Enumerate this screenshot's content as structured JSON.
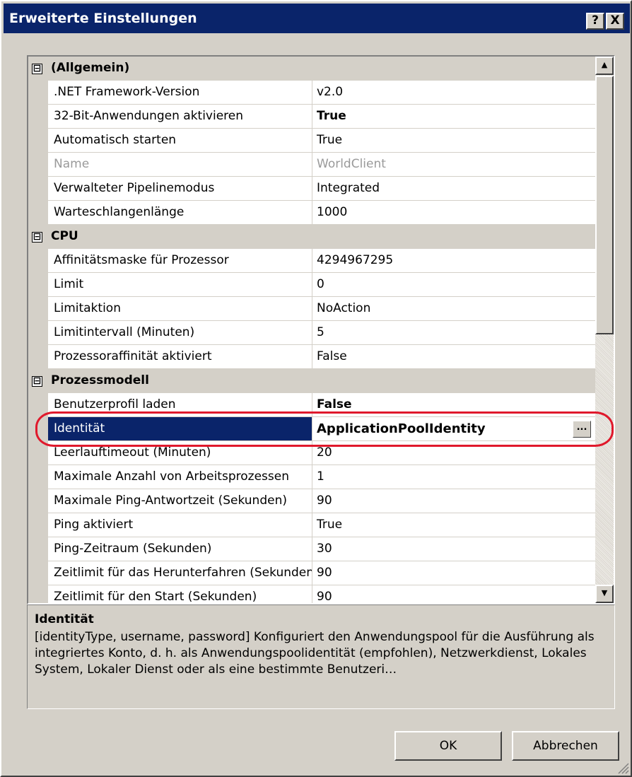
{
  "window": {
    "title": "Erweiterte Einstellungen",
    "help_button": "?",
    "close_button": "X"
  },
  "property_grid": {
    "rows": [
      {
        "kind": "category",
        "name": "(Allgemein)",
        "toggle": "⊟"
      },
      {
        "kind": "prop",
        "name": ".NET Framework-Version",
        "value": "v2.0"
      },
      {
        "kind": "prop",
        "name": "32-Bit-Anwendungen aktivieren",
        "value": "True",
        "bold": true
      },
      {
        "kind": "prop",
        "name": "Automatisch starten",
        "value": "True"
      },
      {
        "kind": "prop",
        "name": "Name",
        "value": "WorldClient",
        "readonly": true
      },
      {
        "kind": "prop",
        "name": "Verwalteter Pipelinemodus",
        "value": "Integrated"
      },
      {
        "kind": "prop",
        "name": "Warteschlangenlänge",
        "value": "1000"
      },
      {
        "kind": "category",
        "name": "CPU",
        "toggle": "⊟"
      },
      {
        "kind": "prop",
        "name": "Affinitätsmaske für Prozessor",
        "value": "4294967295"
      },
      {
        "kind": "prop",
        "name": "Limit",
        "value": "0"
      },
      {
        "kind": "prop",
        "name": "Limitaktion",
        "value": "NoAction"
      },
      {
        "kind": "prop",
        "name": "Limitintervall (Minuten)",
        "value": "5"
      },
      {
        "kind": "prop",
        "name": "Prozessoraffinität aktiviert",
        "value": "False"
      },
      {
        "kind": "category",
        "name": "Prozessmodell",
        "toggle": "⊟"
      },
      {
        "kind": "prop",
        "name": "Benutzerprofil laden",
        "value": "False",
        "bold": true
      },
      {
        "kind": "prop",
        "name": "Identität",
        "value": "ApplicationPoolIdentity",
        "selected": true,
        "ellipsis": "..."
      },
      {
        "kind": "prop",
        "name": "Leerlauftimeout (Minuten)",
        "value": "20"
      },
      {
        "kind": "prop",
        "name": "Maximale Anzahl von Arbeitsprozessen",
        "value": "1"
      },
      {
        "kind": "prop",
        "name": "Maximale Ping-Antwortzeit (Sekunden)",
        "value": "90"
      },
      {
        "kind": "prop",
        "name": "Ping aktiviert",
        "value": "True"
      },
      {
        "kind": "prop",
        "name": "Ping-Zeitraum (Sekunden)",
        "value": "30"
      },
      {
        "kind": "prop",
        "name": "Zeitlimit für das Herunterfahren (Sekunden)",
        "value": "90"
      },
      {
        "kind": "prop",
        "name": "Zeitlimit für den Start (Sekunden)",
        "value": "90"
      }
    ]
  },
  "description": {
    "title": "Identität",
    "text": "[identityType, username, password] Konfiguriert den Anwendungspool für die Ausführung als integriertes Konto, d. h. als Anwendungspoolidentität (empfohlen), Netzwerkdienst, Lokales System, Lokaler Dienst oder als eine bestimmte Benutzeri…"
  },
  "buttons": {
    "ok": "OK",
    "cancel": "Abbrechen"
  },
  "colors": {
    "titlebar": "#0a246a",
    "selection": "#0a246a",
    "highlight_ring": "#e0192c"
  }
}
